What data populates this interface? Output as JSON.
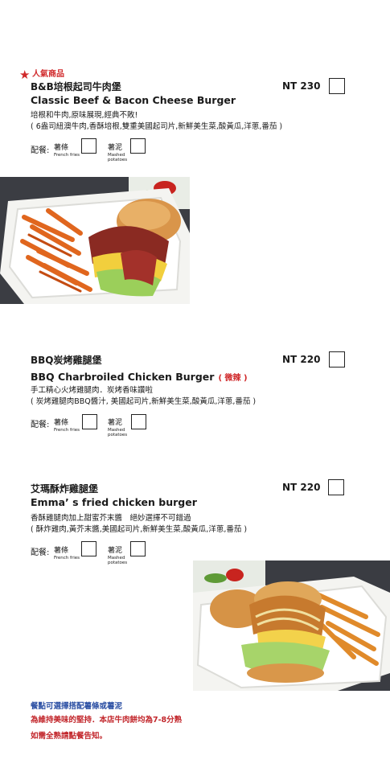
{
  "items": [
    {
      "badge": "人氣商品",
      "name_cn": "B&B培根起司牛肉堡",
      "name_en": "Classic Beef & Bacon Cheese Burger",
      "price": "NT 230",
      "desc1": "培根和牛肉,原味展現,經典不敗!",
      "desc2": "( 6盎司紐澳牛肉,香酥培根,雙重美國起司片,新鮮美生菜,酸黃瓜,洋蔥,番茄 )",
      "side_label": "配餐:",
      "fries_cn": "薯條",
      "fries_en": "French fries",
      "mashed_cn": "薯泥",
      "mashed_en1": "Mashed",
      "mashed_en2": "potatoes"
    },
    {
      "name_cn": "BBQ炭烤雞腿堡",
      "name_en": "BBQ Charbroiled Chicken Burger",
      "spicy": "( 微辣 )",
      "price": "NT 220",
      "desc1": "手工精心火烤雞腿肉．炭烤香味讚啦",
      "desc2": "( 炭烤雞腿肉BBQ醬汁, 美國起司片,新鮮美生菜,酸黃瓜,洋蔥,番茄 )",
      "side_label": "配餐:",
      "fries_cn": "薯條",
      "fries_en": "French fries",
      "mashed_cn": "薯泥",
      "mashed_en1": "Mashed",
      "mashed_en2": "potatoes"
    },
    {
      "name_cn": "艾瑪酥炸雞腿堡",
      "name_en": "Emma’ s fried chicken burger",
      "price": "NT 220",
      "desc1": "香酥雞腿肉加上甜蜜芥末醬　絕妙選擇不可錯過",
      "desc2": "( 酥炸雞肉,黃芥末醬,美國起司片,新鮮美生菜,酸黃瓜,洋蔥,番茄 )",
      "side_label": "配餐:",
      "fries_cn": "薯條",
      "fries_en": "French fries",
      "mashed_cn": "薯泥",
      "mashed_en1": "Mashed",
      "mashed_en2": "potatoes"
    }
  ],
  "notes": {
    "line1": "餐點可選擇搭配薯條或薯泥",
    "line2": "為維持美味的堅持．本店牛肉餅均為7-8分熟",
    "line3": "如需全熟請點餐告知。"
  },
  "colors": {
    "accent_red": "#d0282a",
    "note_blue": "#2b4fa3",
    "text": "#1a1a1a"
  },
  "icons": {
    "badge": "star-icon"
  }
}
